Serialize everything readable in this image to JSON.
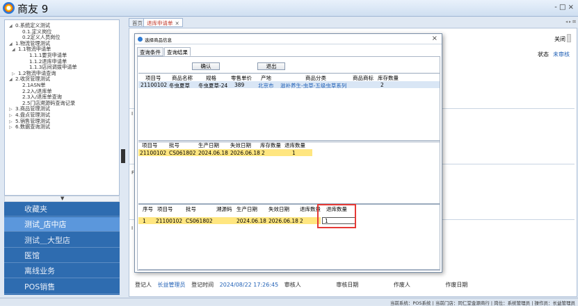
{
  "app": {
    "title": "商友 9",
    "window_controls": "- □ ×"
  },
  "tree": [
    {
      "label": "0.系统定义测试",
      "arrow": "◢"
    },
    {
      "label": "0.1.定义岗位",
      "arrow": ""
    },
    {
      "label": "0.2定义人员岗位",
      "arrow": ""
    },
    {
      "label": "1.物流管理测试",
      "arrow": "◢"
    },
    {
      "label": "1.1物流申请单",
      "arrow": "◢"
    },
    {
      "label": "1.1.1要货申请单",
      "arrow": ""
    },
    {
      "label": "1.1.2退库申请单",
      "arrow": ""
    },
    {
      "label": "1.1.3店间调拨申请单",
      "arrow": ""
    },
    {
      "label": "1.2物流申请查询",
      "arrow": "▷"
    },
    {
      "label": "2.收货管理测试",
      "arrow": "◢"
    },
    {
      "label": "2.1ASN单",
      "arrow": ""
    },
    {
      "label": "2.2入/退库单",
      "arrow": ""
    },
    {
      "label": "2.3入/退库单查询",
      "arrow": ""
    },
    {
      "label": "2.5门店溯源码查询记录",
      "arrow": ""
    },
    {
      "label": "3.商品管理测试",
      "arrow": "▷"
    },
    {
      "label": "4.盘点管理测试",
      "arrow": "▷"
    },
    {
      "label": "5.销售管理测试",
      "arrow": "▷"
    },
    {
      "label": "6.数据查询测试",
      "arrow": "▷"
    }
  ],
  "scroll_arrow": "▼",
  "sidenav": [
    {
      "label": "收藏夹",
      "active": false
    },
    {
      "label": "测试_店中店",
      "active": true
    },
    {
      "label": "测试＿大型店",
      "active": false
    },
    {
      "label": "医馆",
      "active": false
    },
    {
      "label": "离线业务",
      "active": false
    },
    {
      "label": "POS销售",
      "active": false
    }
  ],
  "tabs": {
    "home": "首页",
    "current": "退库申请单",
    "close": "×",
    "nav": "◂ ▸ ⊠"
  },
  "form": {
    "close_label": "关闭",
    "status_label": "状态",
    "status_value": "未审核",
    "left_labels": [
      "I",
      "F",
      "I"
    ]
  },
  "footer": {
    "registrant_label": "登记人",
    "registrant_value": "长益管理员",
    "reg_time_label": "登记时间",
    "reg_time_value": "2024/08/22 17:26:45",
    "auditor_label": "审核人",
    "audit_date_label": "审核日期",
    "voider_label": "作废人",
    "void_date_label": "作废日期"
  },
  "dialog": {
    "title": "选择商品信息",
    "close": "×",
    "tabs": [
      "查询条件",
      "查询结果"
    ],
    "confirm": "确认",
    "exit": "退出",
    "grid1": {
      "headers": [
        "项目号",
        "商品名称",
        "规格",
        "零售单价",
        "产地",
        "商品分类",
        "商品商标",
        "库存数量"
      ],
      "rows": [
        [
          "21100102",
          "冬虫夏草",
          "冬虫夏草-24",
          "389",
          "北京市",
          "滋补养生-虫草-五级虫草系列",
          "",
          "2"
        ]
      ]
    },
    "grid2": {
      "headers": [
        "项目号",
        "批号",
        "生产日期",
        "失效日期",
        "库存数量",
        "退库数量"
      ],
      "rows": [
        [
          "21100102",
          "CS061802",
          "2024.06.18",
          "2026.06.18",
          "2",
          "1"
        ]
      ]
    },
    "grid3": {
      "headers": [
        "序号",
        "项目号",
        "批号",
        "溯源码",
        "生产日期",
        "失效日期",
        "退库数量",
        "退库数量"
      ],
      "rows": [
        [
          "1",
          "21100102",
          "CS061802",
          "",
          "2024.06.18",
          "2026.06.18",
          "2",
          "1"
        ]
      ]
    }
  },
  "statusbar": "当前系统：POS系统 | 当前门店：同仁堂金源商行 | 岗位：系统管理员 | 操作员：长益管理员"
}
